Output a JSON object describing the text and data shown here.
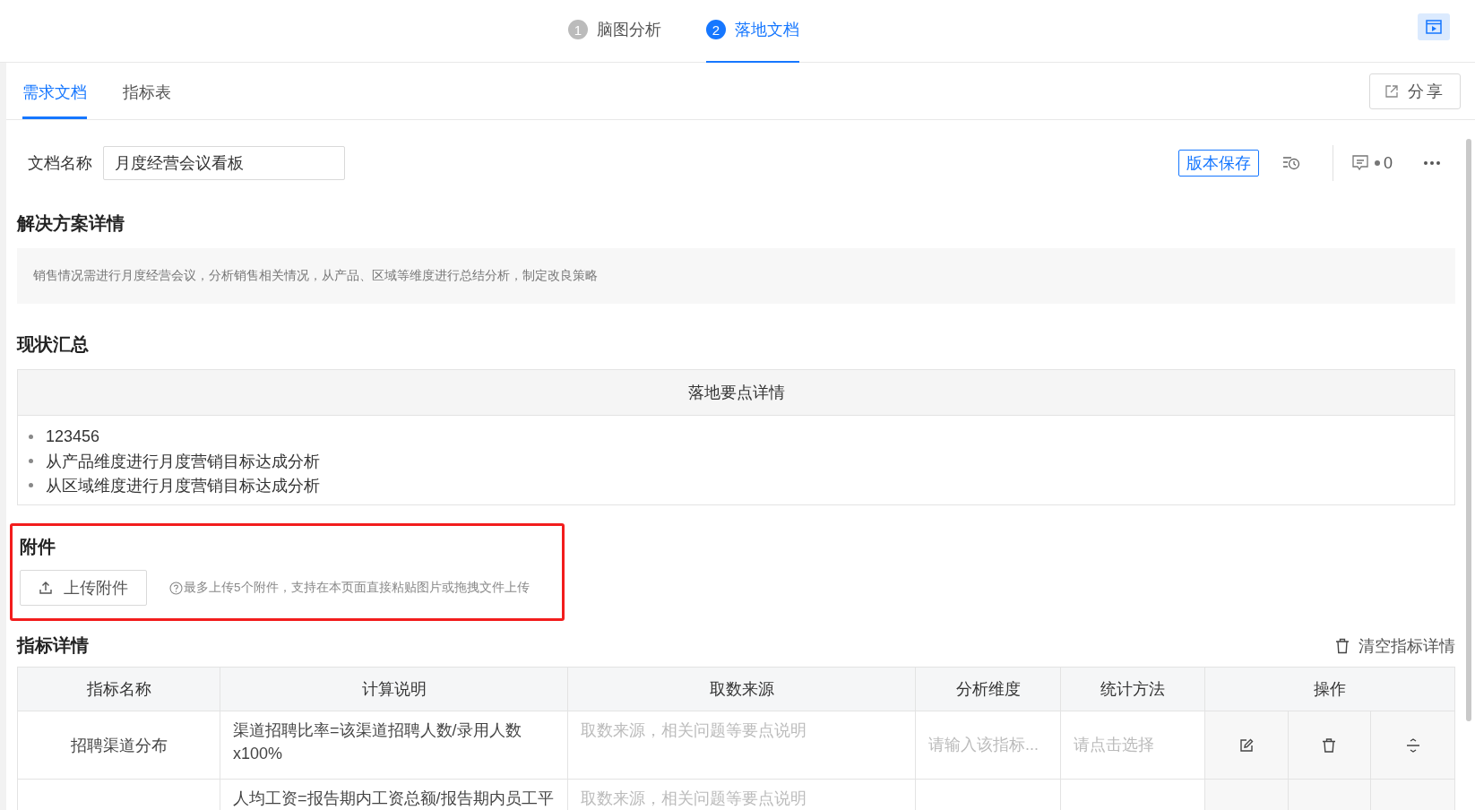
{
  "steps": [
    {
      "number": "1",
      "label": "脑图分析",
      "selected": false
    },
    {
      "number": "2",
      "label": "落地文档",
      "selected": true
    }
  ],
  "tabs": [
    {
      "label": "需求文档",
      "selected": true
    },
    {
      "label": "指标表",
      "selected": false
    }
  ],
  "share_button": "分享",
  "document": {
    "name_label": "文档名称",
    "name_value": "月度经营会议看板",
    "save_button": "版本保存",
    "comment_count": "0"
  },
  "solution": {
    "title": "解决方案详情",
    "text": "销售情况需进行月度经营会议，分析销售相关情况，从产品、区域等维度进行总结分析，制定改良策略"
  },
  "status": {
    "title": "现状汇总",
    "table_header": "落地要点详情",
    "items": [
      "123456",
      "从产品维度进行月度营销目标达成分析",
      "从区域维度进行月度营销目标达成分析"
    ]
  },
  "attachments": {
    "title": "附件",
    "upload_button": "上传附件",
    "hint": "最多上传5个附件，支持在本页面直接粘贴图片或拖拽文件上传"
  },
  "metrics": {
    "title": "指标详情",
    "clear_button": "清空指标详情",
    "columns": [
      "指标名称",
      "计算说明",
      "取数来源",
      "分析维度",
      "统计方法",
      "操作"
    ],
    "rows": [
      {
        "name": "招聘渠道分布",
        "calculation": "渠道招聘比率=该渠道招聘人数/录用人数x100%",
        "source_placeholder": "取数来源，相关问题等要点说明",
        "dimension_placeholder": "请输入该指标...",
        "method_placeholder": "请点击选择"
      },
      {
        "calculation": "人均工资=报告期内工资总额/报告期内员工平",
        "source_placeholder": "取数来源，相关问题等要点说明"
      }
    ]
  }
}
